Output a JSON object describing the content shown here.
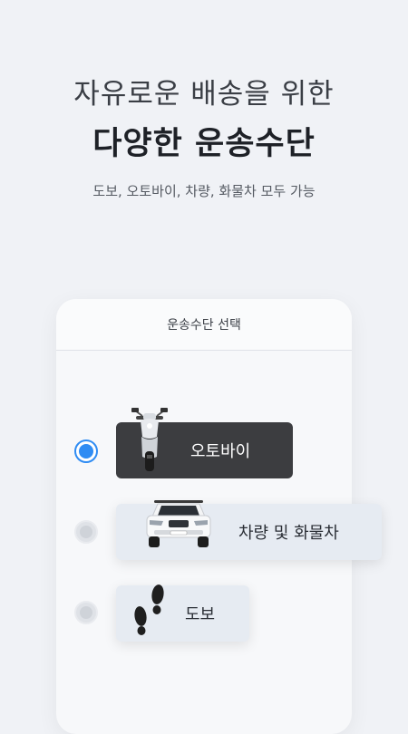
{
  "promo": {
    "headline_line1": "자유로운 배송을 위한",
    "headline_line2": "다양한 운송수단",
    "subtitle": "도보, 오토바이, 차량, 화물차 모두 가능"
  },
  "card": {
    "title": "운송수단 선택",
    "options": [
      {
        "label": "오토바이",
        "icon": "motorcycle-icon",
        "selected": true
      },
      {
        "label": "차량 및 화물차",
        "icon": "car-icon",
        "selected": false
      },
      {
        "label": "도보",
        "icon": "footprints-icon",
        "selected": false
      }
    ]
  },
  "colors": {
    "accent": "#2f8cf3",
    "selected_option_bg": "#3c3d40",
    "option_bg": "#e6ebf2",
    "page_bg": "#f0f2f6"
  }
}
